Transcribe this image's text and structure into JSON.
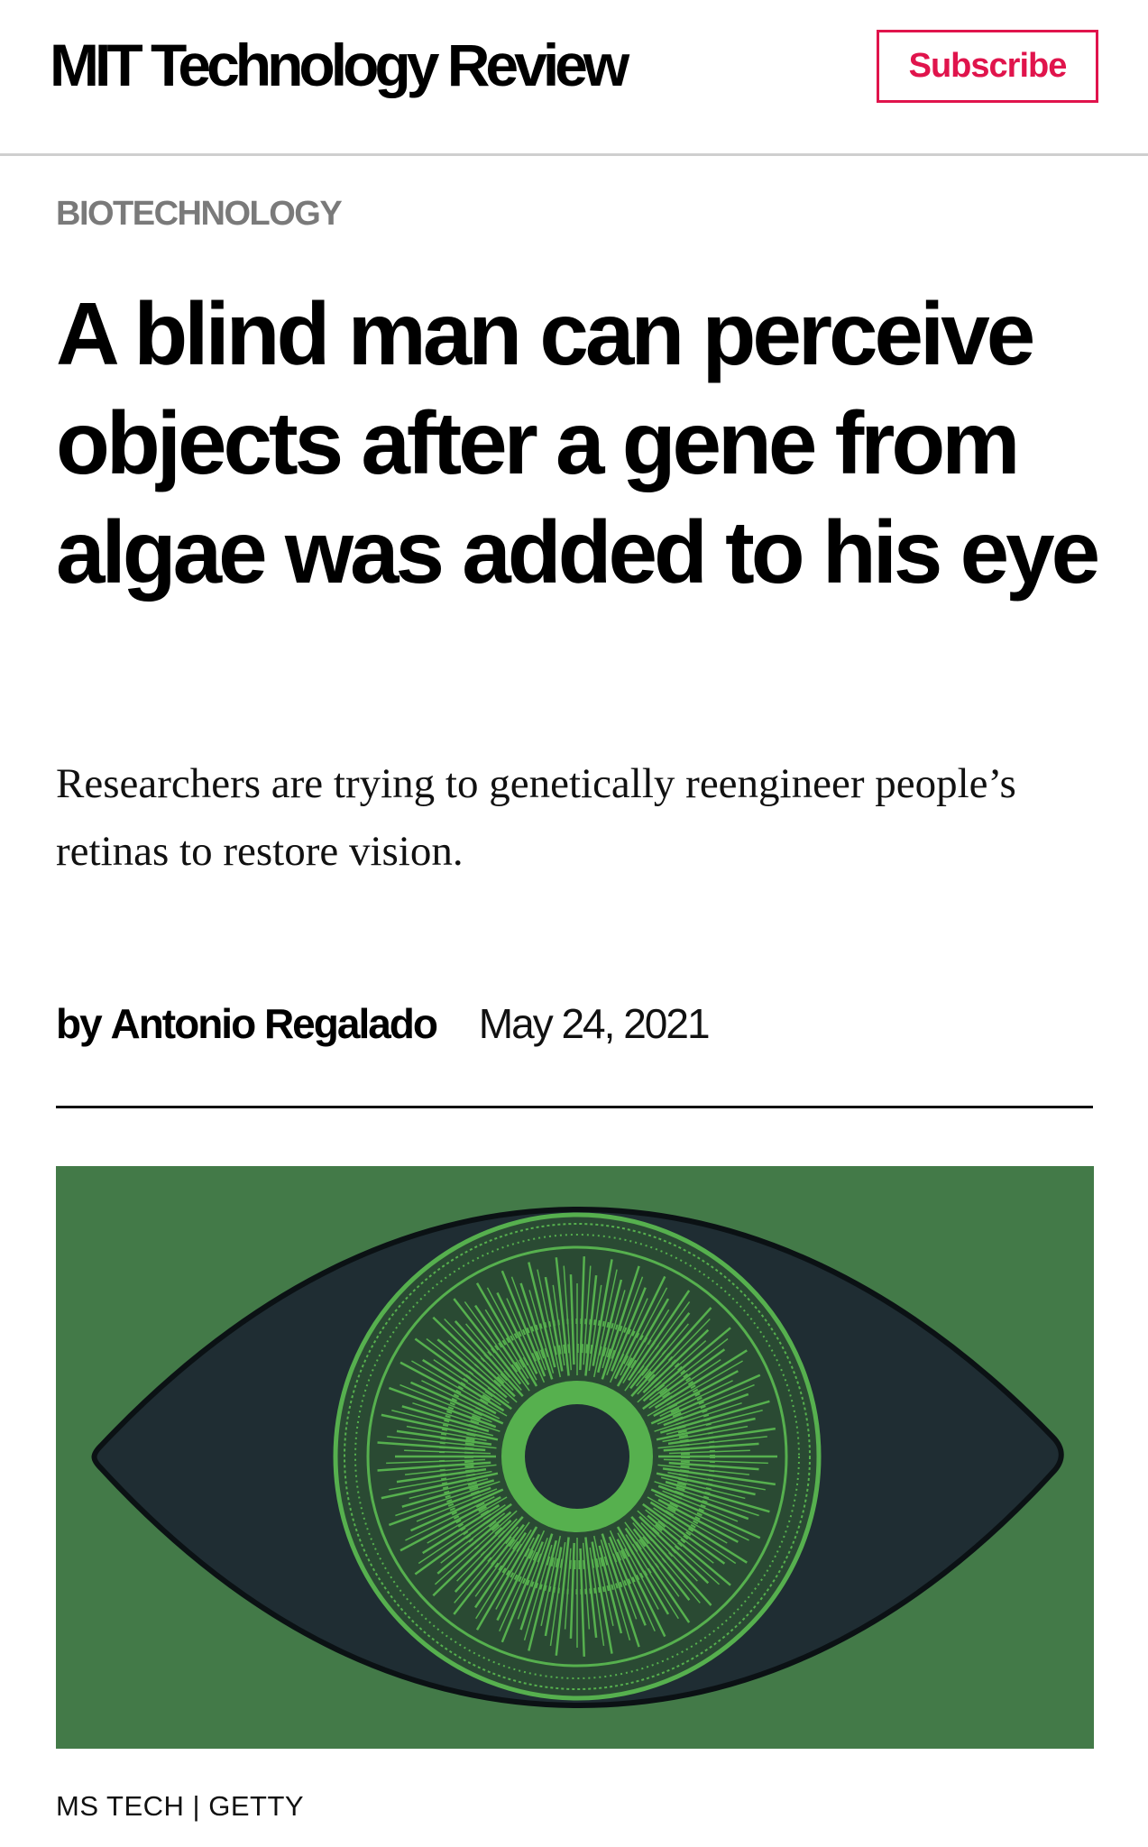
{
  "header": {
    "logo_text": "MIT Technology Review",
    "subscribe_label": "Subscribe"
  },
  "article": {
    "category": "BIOTECHNOLOGY",
    "headline": "A blind man can perceive objects after a gene from algae was added to his eye",
    "dek": "Researchers are trying to genetically reengineer people’s retinas to restore vision.",
    "byline_prefix": "by",
    "author": "Antonio Regalado",
    "date": "May 24, 2021",
    "image_credit": "MS TECH | GETTY"
  },
  "colors": {
    "accent": "#e0144c",
    "category_gray": "#7a7a7a",
    "image_background": "#437a48",
    "eye_dark": "#1f2d33",
    "iris_green": "#56b04e"
  },
  "icons": {
    "hero_image": "eye-illustration"
  }
}
